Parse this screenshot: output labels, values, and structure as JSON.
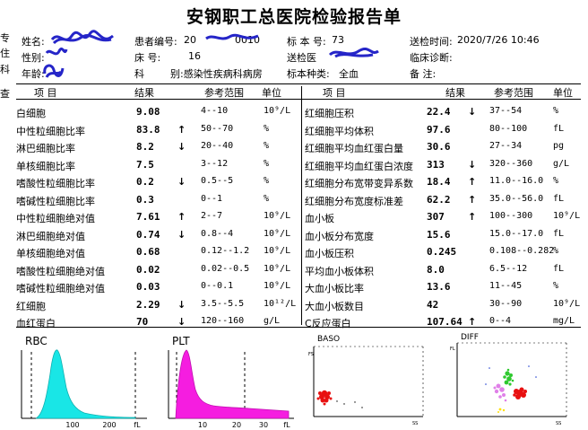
{
  "title": "安钢职工总医院检验报告单",
  "header": {
    "name_label": "姓名:",
    "patient_no_label": "患者编号:",
    "patient_no_value": "20",
    "patient_no_tail": "0010",
    "specimen_no_label": "标 本 号:",
    "specimen_no_value": "73",
    "send_time_label": "送检时间:",
    "send_time_value": "2020/7/26  10:46",
    "sex_label": "性别:",
    "bed_label": "床    号:",
    "bed_value": "16",
    "send_doctor_label": "送检医",
    "diagnosis_label": "临床诊断:",
    "age_label": "年龄:",
    "dept_prefix": "科",
    "dept_value": "别:感染性疾病科病房",
    "specimen_type_label": "标本种类:",
    "specimen_type_value": "全血",
    "remark_label": "备    注:"
  },
  "column_headers": {
    "item": "项    目",
    "result": "结果",
    "ref": "参考范围",
    "unit": "单位"
  },
  "left_rows": [
    {
      "name": "白细胞",
      "value": "9.08",
      "flag": "",
      "range": "4--10",
      "unit": "10⁹/L"
    },
    {
      "name": "中性粒细胞比率",
      "value": "83.8",
      "flag": "↑",
      "range": "50--70",
      "unit": "%"
    },
    {
      "name": "淋巴细胞比率",
      "value": "8.2",
      "flag": "↓",
      "range": "20--40",
      "unit": "%"
    },
    {
      "name": "单核细胞比率",
      "value": "7.5",
      "flag": "",
      "range": "3--12",
      "unit": "%"
    },
    {
      "name": "嗜酸性粒细胞比率",
      "value": "0.2",
      "flag": "↓",
      "range": "0.5--5",
      "unit": "%"
    },
    {
      "name": "嗜碱性粒细胞比率",
      "value": "0.3",
      "flag": "",
      "range": "0--1",
      "unit": "%"
    },
    {
      "name": "中性粒细胞绝对值",
      "value": "7.61",
      "flag": "↑",
      "range": "2--7",
      "unit": "10⁹/L"
    },
    {
      "name": "淋巴细胞绝对值",
      "value": "0.74",
      "flag": "↓",
      "range": "0.8--4",
      "unit": "10⁹/L"
    },
    {
      "name": "单核细胞绝对值",
      "value": "0.68",
      "flag": "",
      "range": "0.12--1.2",
      "unit": "10⁹/L"
    },
    {
      "name": "嗜酸性粒细胞绝对值",
      "value": "0.02",
      "flag": "",
      "range": "0.02--0.5",
      "unit": "10⁹/L"
    },
    {
      "name": "嗜碱性粒细胞绝对值",
      "value": "0.03",
      "flag": "",
      "range": "0--0.1",
      "unit": "10⁹/L"
    },
    {
      "name": "红细胞",
      "value": "2.29",
      "flag": "↓",
      "range": "3.5--5.5",
      "unit": "10¹²/L"
    },
    {
      "name": "血红蛋白",
      "value": "70",
      "flag": "↓",
      "range": "120--160",
      "unit": "g/L"
    }
  ],
  "right_rows": [
    {
      "name": "红细胞压积",
      "value": "22.4",
      "flag": "↓",
      "range": "37--54",
      "unit": "%"
    },
    {
      "name": "红细胞平均体积",
      "value": "97.6",
      "flag": "",
      "range": "80--100",
      "unit": "fL"
    },
    {
      "name": "红细胞平均血红蛋白量",
      "value": "30.6",
      "flag": "",
      "range": "27--34",
      "unit": "pg"
    },
    {
      "name": "红细胞平均血红蛋白浓度",
      "value": "313",
      "flag": "↓",
      "range": "320--360",
      "unit": "g/L"
    },
    {
      "name": "红细胞分布宽带变异系数",
      "value": "18.4",
      "flag": "↑",
      "range": "11.0--16.0",
      "unit": "%"
    },
    {
      "name": "红细胞分布宽度标准差",
      "value": "62.2",
      "flag": "↑",
      "range": "35.0--56.0",
      "unit": "fL"
    },
    {
      "name": "血小板",
      "value": "307",
      "flag": "↑",
      "range": "100--300",
      "unit": "10⁹/L"
    },
    {
      "name": "血小板分布宽度",
      "value": "15.6",
      "flag": "",
      "range": "15.0--17.0",
      "unit": "fL"
    },
    {
      "name": "血小板压积",
      "value": "0.245",
      "flag": "",
      "range": "0.108--0.282",
      "unit": "%"
    },
    {
      "name": "平均血小板体积",
      "value": "8.0",
      "flag": "",
      "range": "6.5--12",
      "unit": "fL"
    },
    {
      "name": "大血小板比率",
      "value": "13.6",
      "flag": "",
      "range": "11--45",
      "unit": "%"
    },
    {
      "name": "大血小板数目",
      "value": "42",
      "flag": "",
      "range": "30--90",
      "unit": "10⁹/L"
    },
    {
      "name": "C反应蛋白",
      "value": "107.64",
      "flag": "↑",
      "range": "0--4",
      "unit": "mg/L"
    }
  ],
  "plots": {
    "rbc": {
      "label": "RBC",
      "ticks": [
        "100",
        "200",
        "fL"
      ]
    },
    "plt": {
      "label": "PLT",
      "ticks": [
        "10",
        "20",
        "30",
        "fL"
      ]
    },
    "baso": {
      "label": "BASO",
      "x_label": "SS",
      "y_label": "FS"
    },
    "diff": {
      "label": "DIFF",
      "x_label": "SS",
      "y_label": "FL"
    }
  },
  "left_edge": [
    "专",
    "住",
    "科",
    "查"
  ],
  "colors": {
    "rbc": "#19e6e6",
    "plt": "#f51de0",
    "baso_dots": "#e81010",
    "diff_green": "#2fc92f",
    "diff_pink": "#e080e8",
    "diff_red": "#e81010",
    "diff_yellow": "#ffe000"
  }
}
